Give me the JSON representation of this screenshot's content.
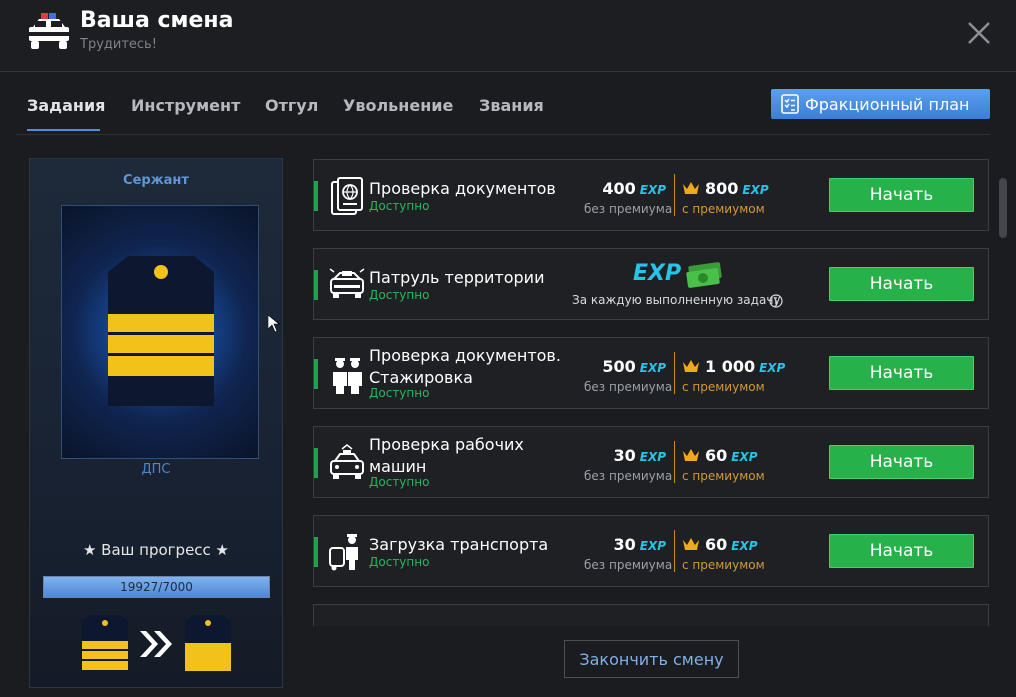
{
  "header": {
    "title": "Ваша смена",
    "subtitle": "Трудитесь!"
  },
  "tabs": [
    {
      "label": "Задания",
      "active": true
    },
    {
      "label": "Инструмент",
      "active": false
    },
    {
      "label": "Отгул",
      "active": false
    },
    {
      "label": "Увольнение",
      "active": false
    },
    {
      "label": "Звания",
      "active": false
    }
  ],
  "plan_button": {
    "label": "Фракционный план"
  },
  "rank": {
    "name": "Сержант",
    "department": "ДПС",
    "progress_title": "★ Ваш прогресс ★",
    "progress_text": "19927/7000",
    "progress_fraction": 1.0
  },
  "tasks": [
    {
      "name": "Проверка документов",
      "status": "Доступно",
      "value": "400",
      "value_label": "без премиума",
      "premium_value": "800",
      "premium_label": "с премиумом",
      "button": "Начать",
      "icon": "passport-icon"
    },
    {
      "name": "Патруль территории",
      "status": "Доступно",
      "reward_note": "За каждую выполненную задачу",
      "button": "Начать",
      "icon": "police-car-icon"
    },
    {
      "name": "Проверка документов.\nСтажировка",
      "status": "Доступно",
      "value": "500",
      "value_label": "без премиума",
      "premium_value": "1 000",
      "premium_label": "с премиумом",
      "button": "Начать",
      "icon": "officers-icon"
    },
    {
      "name": "Проверка рабочих\nмашин",
      "status": "Доступно",
      "value": "30",
      "value_label": "без премиума",
      "premium_value": "60",
      "premium_label": "с премиумом",
      "button": "Начать",
      "icon": "patrol-car-icon"
    },
    {
      "name": "Загрузка транспорта",
      "status": "Доступно",
      "value": "30",
      "value_label": "без премиума",
      "premium_value": "60",
      "premium_label": "с премиумом",
      "button": "Начать",
      "icon": "loading-icon"
    }
  ],
  "exp_label": "EXP",
  "finish_button": {
    "label": "Закончить смену"
  },
  "colors": {
    "accent_blue": "#4a8fe0",
    "start_green": "#27b14a",
    "status_green": "#2bb55a",
    "exp_cyan": "#28c3e8",
    "premium_gold": "#d19a33"
  }
}
